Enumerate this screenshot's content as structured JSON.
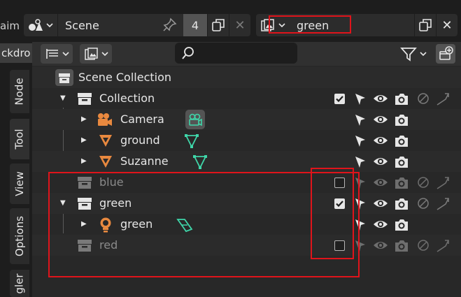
{
  "topbar": {
    "left_partial": "aim",
    "scene": {
      "name": "Scene",
      "users": "4"
    },
    "view_layer": {
      "name": "green"
    }
  },
  "left_tabs": {
    "backdrop_partial": "ckdro",
    "tabs": [
      "Node",
      "Tool",
      "View",
      "Options",
      "gler"
    ]
  },
  "outliner": {
    "search_placeholder": "",
    "root": "Scene Collection",
    "rows": [
      {
        "label": "Collection",
        "type": "collection",
        "checked": true,
        "excluded": false
      },
      {
        "label": "Camera",
        "type": "object-camera"
      },
      {
        "label": "ground",
        "type": "object-mesh"
      },
      {
        "label": "Suzanne",
        "type": "object-mesh"
      },
      {
        "label": "blue",
        "type": "collection",
        "checked": false,
        "excluded": true
      },
      {
        "label": "green",
        "type": "collection",
        "checked": true,
        "excluded": false
      },
      {
        "label": "green",
        "type": "object-light"
      },
      {
        "label": "red",
        "type": "collection",
        "checked": false,
        "excluded": true
      }
    ]
  },
  "colors": {
    "highlight": "#e0141b",
    "object_orange": "#e9893f",
    "data_green": "#3fd6a9",
    "panel_bg": "#282828"
  },
  "icons": [
    "scene-icon",
    "pin-icon",
    "duplicate-icon",
    "close-icon",
    "view-layer-icon",
    "display-mode-icon",
    "search-icon",
    "filter-icon",
    "new-collection-icon",
    "collection-icon",
    "camera-icon",
    "camera-data-icon",
    "mesh-icon",
    "mesh-data-icon",
    "light-icon",
    "light-data-icon",
    "select-arrow-icon",
    "eye-icon",
    "render-camera-icon",
    "holdout-icon",
    "indirect-only-icon"
  ]
}
